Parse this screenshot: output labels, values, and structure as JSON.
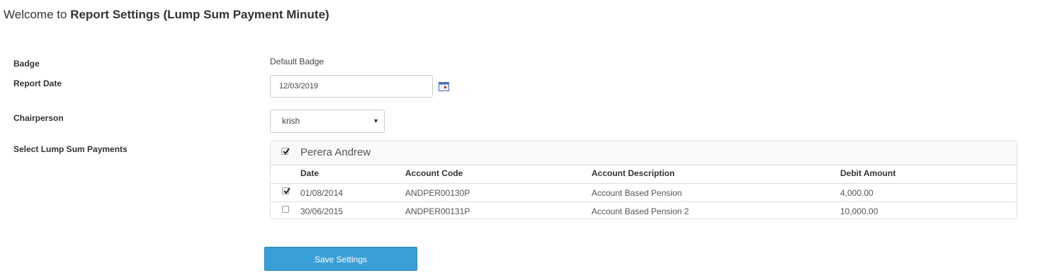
{
  "page": {
    "title_prefix": "Welcome to",
    "title_bold": "Report Settings (Lump Sum Payment Minute)"
  },
  "form": {
    "badge_label": "Badge",
    "badge_value": "Default Badge",
    "report_date_label": "Report Date",
    "report_date_value": "12/03/2019",
    "chairperson_label": "Chairperson",
    "chairperson_value": "krish",
    "payments_label": "Select Lump Sum Payments"
  },
  "payments": {
    "group_name": "Perera Andrew",
    "group_checked": true,
    "columns": [
      "Date",
      "Account Code",
      "Account Description",
      "Debit Amount"
    ],
    "rows": [
      {
        "checked": true,
        "date": "01/08/2014",
        "code": "ANDPER00130P",
        "description": "Account Based Pension",
        "amount": "4,000.00"
      },
      {
        "checked": false,
        "date": "30/06/2015",
        "code": "ANDPER00131P",
        "description": "Account Based Pension 2",
        "amount": "10,000.00"
      }
    ]
  },
  "actions": {
    "save_label": "Save Settings"
  },
  "colors": {
    "primary": "#3aa0d8",
    "border": "#dddddd"
  }
}
